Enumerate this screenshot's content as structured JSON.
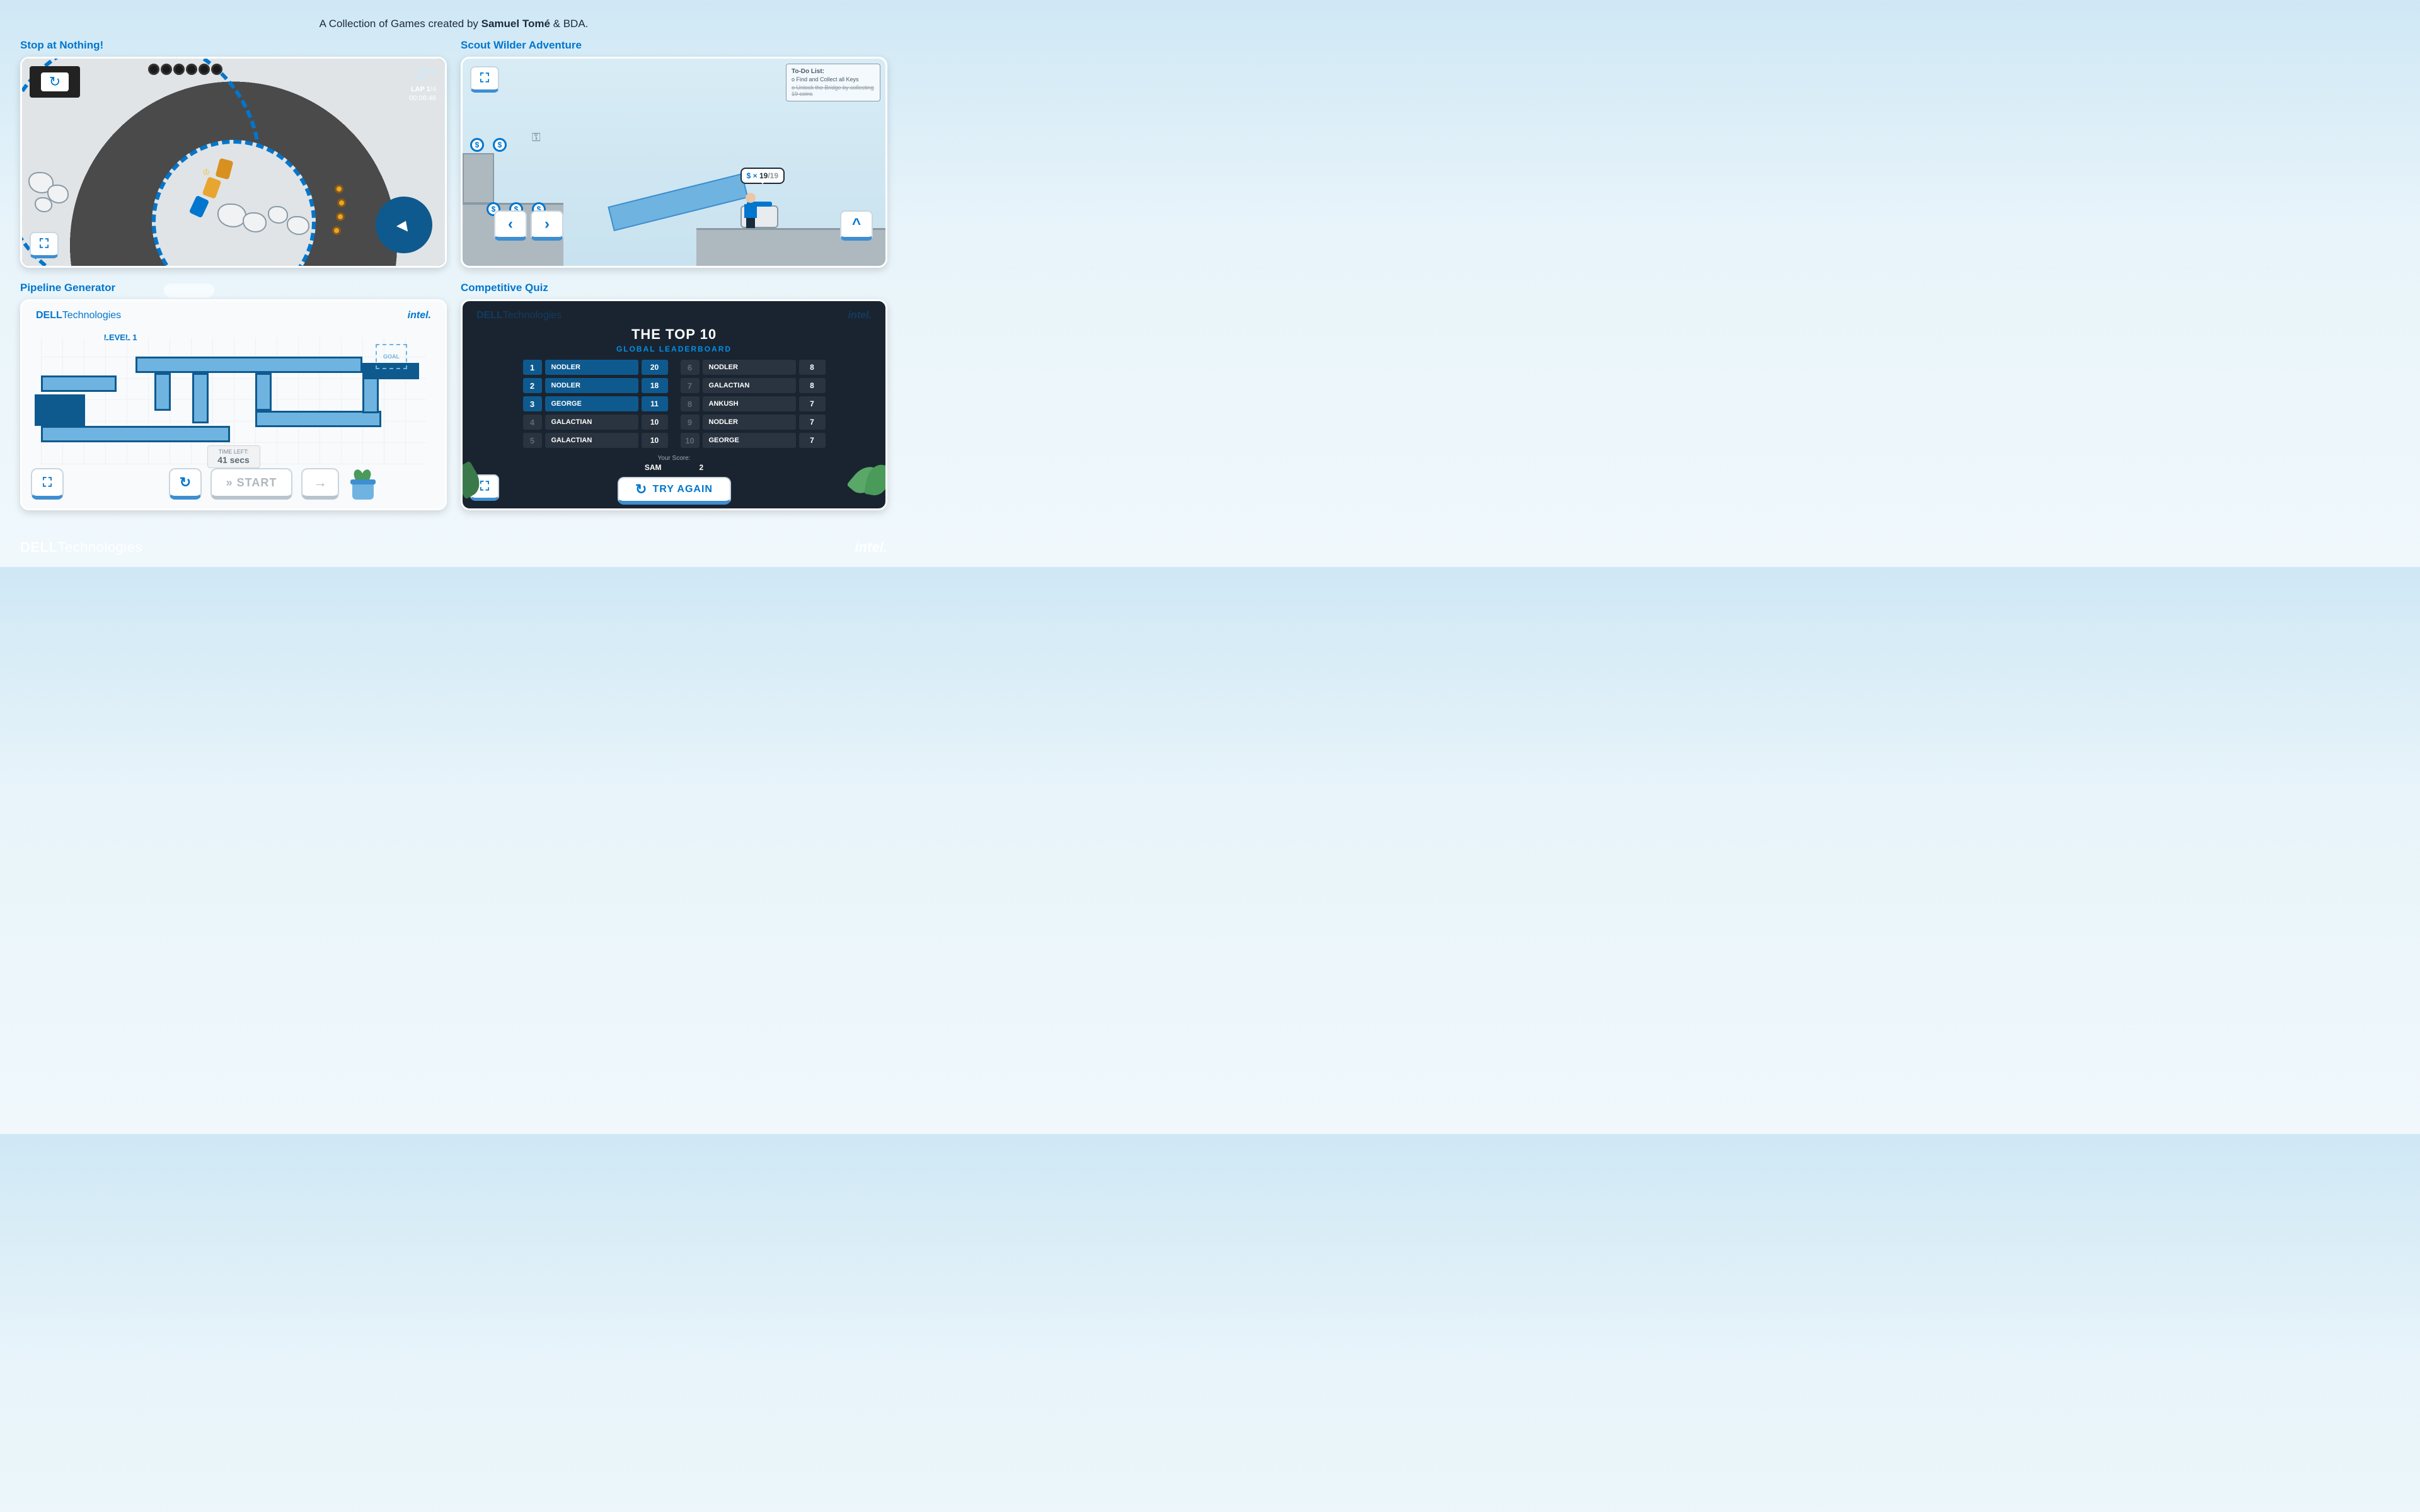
{
  "header": {
    "prefix": "A Collection of Games created by ",
    "author": "Samuel Tomé",
    "suffix": " & BDA."
  },
  "footer": {
    "dell_bold": "DELL",
    "dell_light": "Technologies",
    "intel": "intel."
  },
  "tiles": {
    "racing": {
      "title": "Stop at Nothing!",
      "position": "2",
      "position_suffix": "ND",
      "lap_label": "LAP 1",
      "lap_total": "/4",
      "time": "00:08:46"
    },
    "platformer": {
      "title": "Scout Wilder Adventure",
      "todo_title": "To-Do List:",
      "todo_1": "o Find and Collect all Keys",
      "todo_2": "o Unlock the Bridge by collecting 19 coins",
      "counter_prefix": "$ × ",
      "counter_val": "19",
      "counter_total": "/19",
      "coin_glyph": "$"
    },
    "pipeline": {
      "title": "Pipeline Generator",
      "dell_bold": "DELL",
      "dell_light": "Technologies",
      "intel": "intel.",
      "level": "LEVEL 1",
      "goal": "GOAL",
      "timer_label": "TIME LEFT:",
      "timer_value": "41 secs",
      "start": "» START"
    },
    "quiz": {
      "title": "Competitive Quiz",
      "dell_bold": "DELL",
      "dell_light": "Technologies",
      "intel": "intel.",
      "board_title": "THE TOP 10",
      "board_sub": "GLOBAL LEADERBOARD",
      "left": [
        {
          "rank": "1",
          "name": "NODLER",
          "score": "20",
          "top": true
        },
        {
          "rank": "2",
          "name": "NODLER",
          "score": "18",
          "top": true
        },
        {
          "rank": "3",
          "name": "GEORGE",
          "score": "11",
          "top": true
        },
        {
          "rank": "4",
          "name": "GALACTIAN",
          "score": "10"
        },
        {
          "rank": "5",
          "name": "GALACTIAN",
          "score": "10"
        }
      ],
      "right": [
        {
          "rank": "6",
          "name": "NODLER",
          "score": "8"
        },
        {
          "rank": "7",
          "name": "GALACTIAN",
          "score": "8"
        },
        {
          "rank": "8",
          "name": "ANKUSH",
          "score": "7"
        },
        {
          "rank": "9",
          "name": "NODLER",
          "score": "7"
        },
        {
          "rank": "10",
          "name": "GEORGE",
          "score": "7"
        }
      ],
      "your_label": "Your Score:",
      "your_name": "SAM",
      "your_score": "2",
      "try_again": "TRY AGAIN"
    }
  }
}
